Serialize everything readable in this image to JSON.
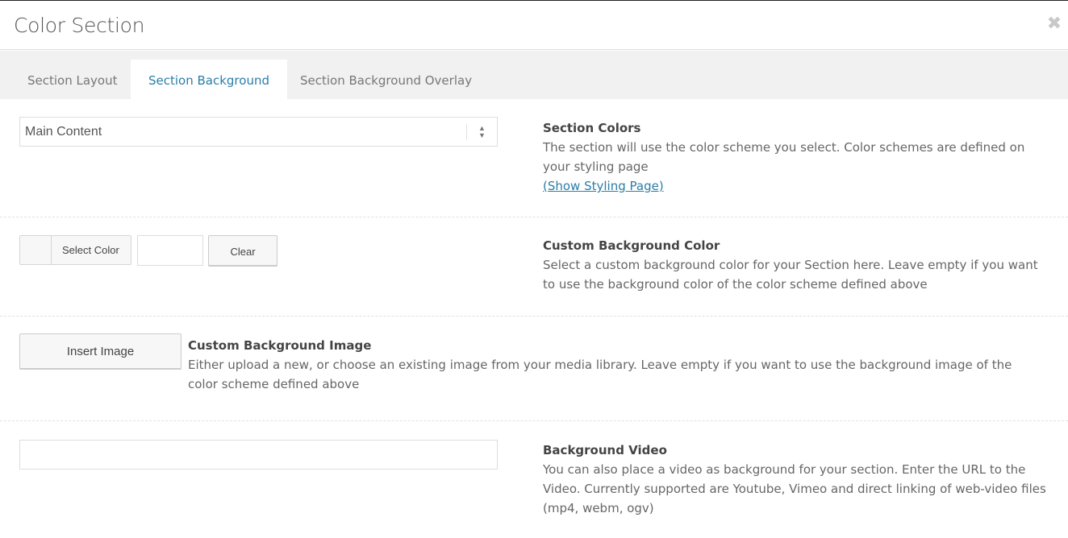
{
  "header": {
    "title": "Color Section",
    "close_icon": "close-icon",
    "close_glyph": "✖"
  },
  "tabs": [
    {
      "label": "Section Layout",
      "active": false
    },
    {
      "label": "Section Background",
      "active": true
    },
    {
      "label": "Section Background Overlay",
      "active": false
    }
  ],
  "colors": {
    "accent": "#2a7ea8",
    "tabs_bar_bg": "#f1f1f1",
    "text": "#666666"
  },
  "section_colors": {
    "select_value": "Main Content",
    "title": "Section Colors",
    "description": "The section will use the color scheme you select. Color schemes are defined on your styling page",
    "link": "(Show Styling Page)"
  },
  "custom_background_color": {
    "select_color_label": "Select Color",
    "color_value": "",
    "clear_label": "Clear",
    "title": "Custom Background Color",
    "description": "Select a custom background color for your Section here. Leave empty if you want to use the background color of the color scheme defined above"
  },
  "custom_background_image": {
    "insert_label": "Insert Image",
    "title": "Custom Background Image",
    "description": "Either upload a new, or choose an existing image from your media library. Leave empty if you want to use the background image of the color scheme defined above"
  },
  "background_video": {
    "value": "",
    "title": "Background Video",
    "description": "You can also place a video as background for your section. Enter the URL to the Video. Currently supported are Youtube, Vimeo and direct linking of web-video files (mp4, webm, ogv)"
  }
}
